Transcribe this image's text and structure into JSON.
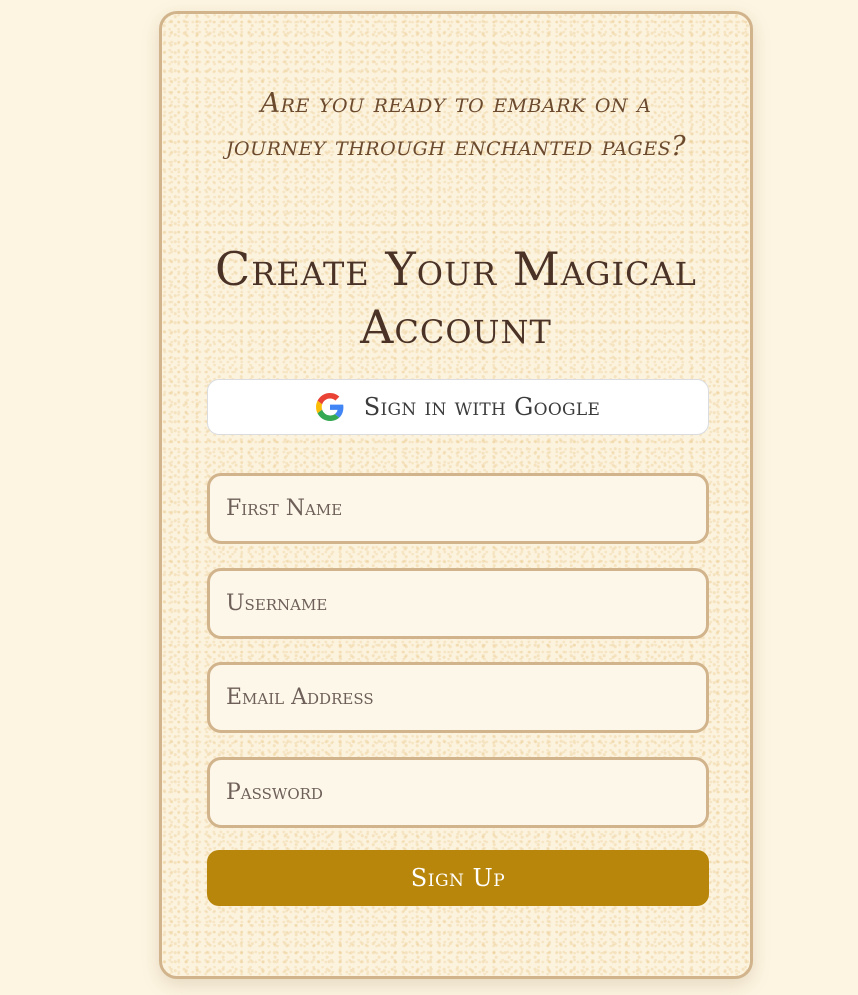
{
  "card": {
    "tagline": "Are you ready to embark on a journey through enchanted pages?",
    "title": "Create Your Magical Account"
  },
  "google": {
    "label": "Sign in with Google",
    "icon": "google-g-icon"
  },
  "form": {
    "first_name_placeholder": "First Name",
    "username_placeholder": "Username",
    "email_placeholder": "Email Address",
    "password_placeholder": "Password",
    "first_name_value": "",
    "username_value": "",
    "email_value": "",
    "password_value": "",
    "submit_label": "Sign Up"
  },
  "colors": {
    "page_background": "#fdf5e2",
    "card_border": "#d2b48c",
    "accent_button": "#b8860b",
    "title_text": "#4a3226"
  }
}
